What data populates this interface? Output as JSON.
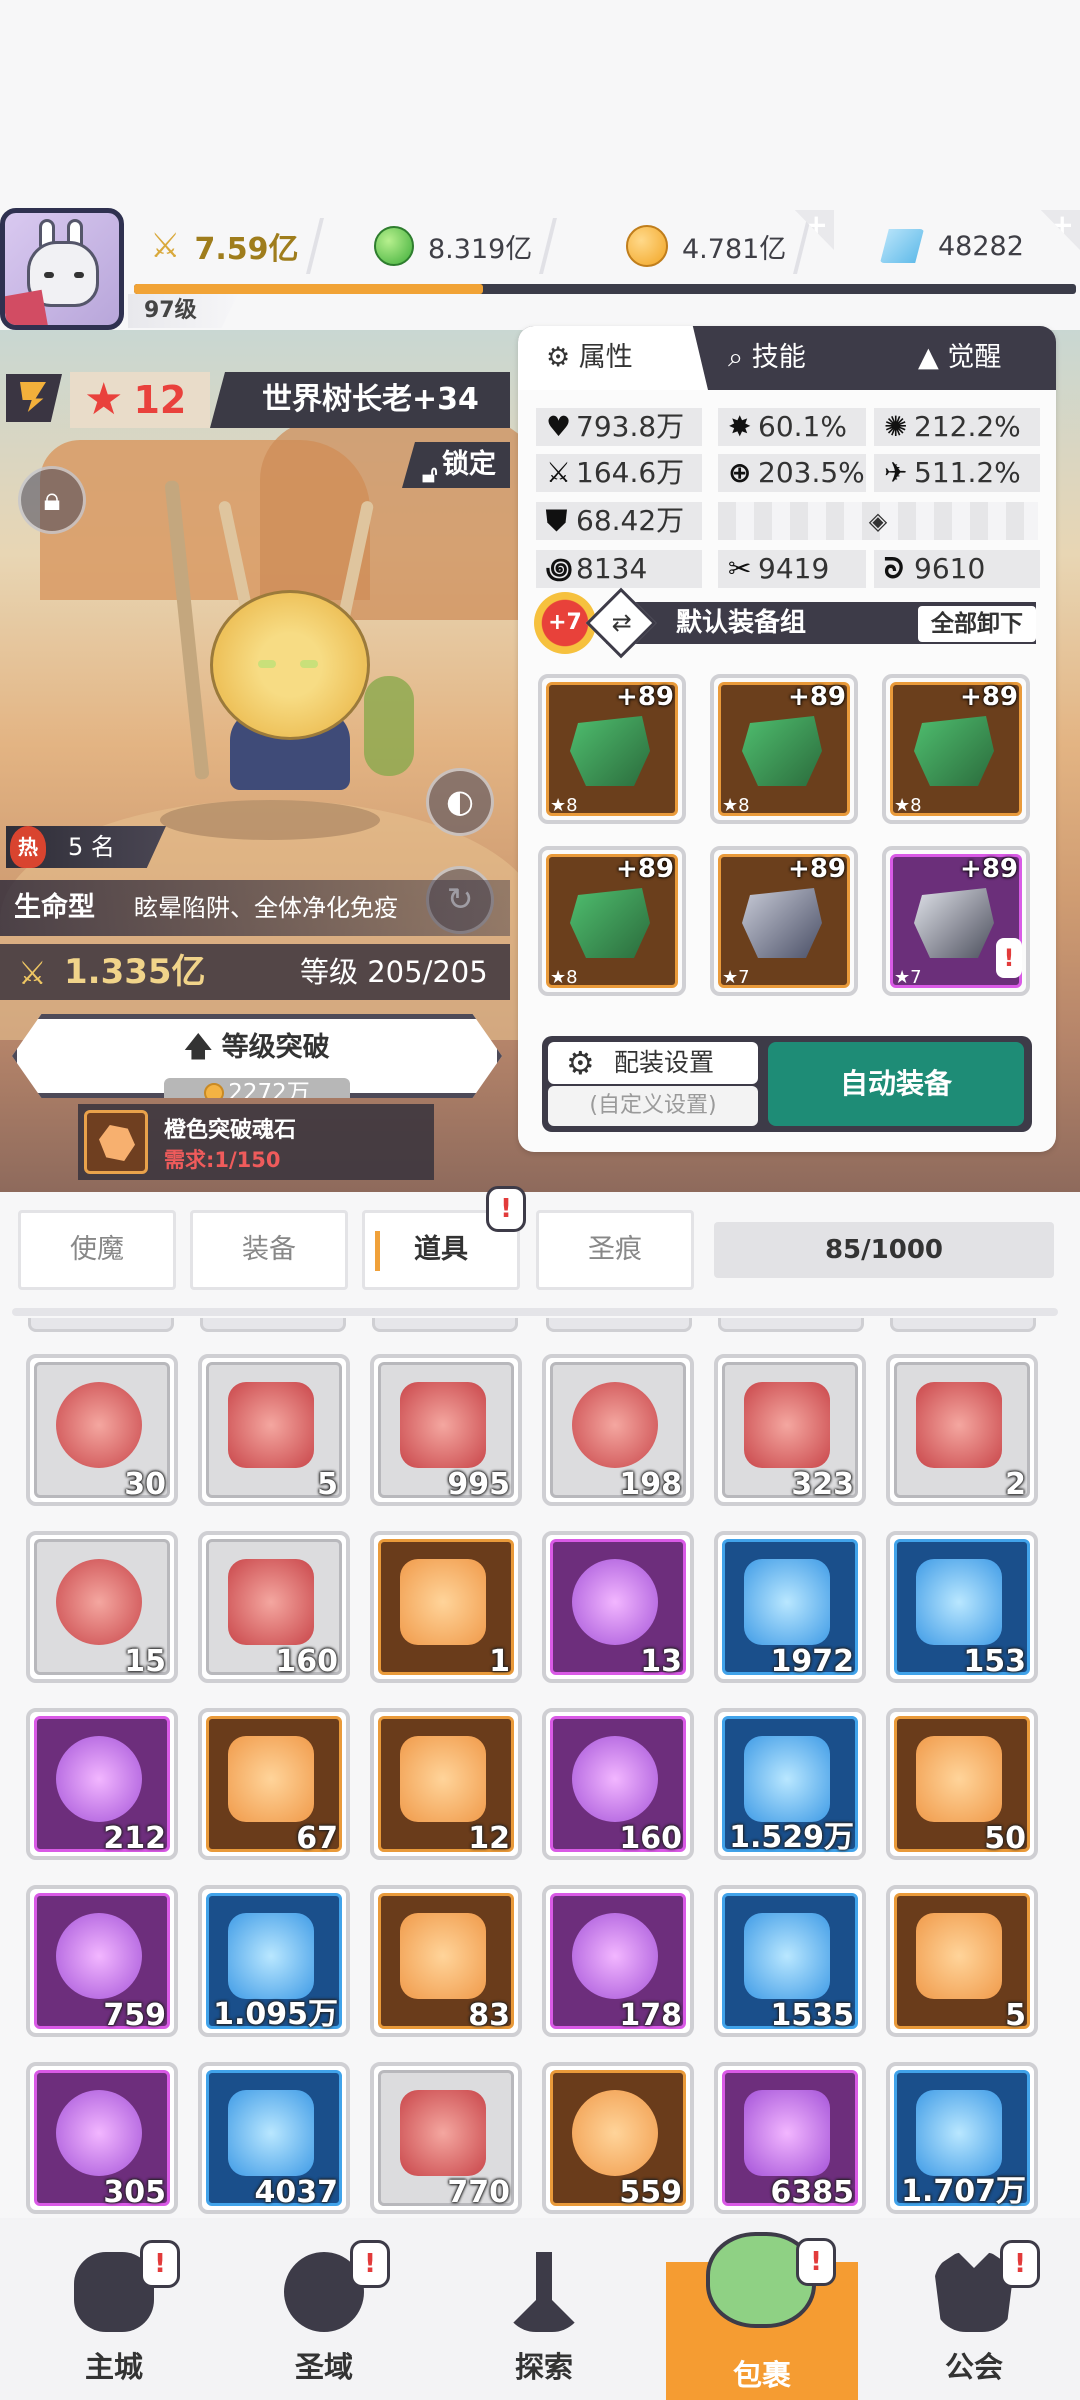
{
  "resources": {
    "power": "7.59亿",
    "green_gem": "8.319亿",
    "gold": "4.781亿",
    "diamond": "48282",
    "player_level": "97级",
    "xp_fraction": 0.37
  },
  "hero": {
    "stars": "12",
    "name": "世界树长老+34",
    "lock_label": "锁定",
    "popularity": "5 名",
    "hot_label": "热",
    "type": "生命型",
    "skills": "眩晕陷阱、全体净化免疫",
    "power": "1.335亿",
    "level": "等级 205/205",
    "breakthrough_label": "等级突破",
    "breakthrough_cost": "2272万",
    "material_name": "橙色突破魂石",
    "material_need": "需求:1/150"
  },
  "panel": {
    "tabs": [
      "属性",
      "技能",
      "觉醒"
    ],
    "stats": {
      "hp": "793.8万",
      "crit": "60.1%",
      "crit_dmg": "212.2%",
      "atk": "164.6万",
      "acc": "203.5%",
      "speed": "511.2%",
      "def": "68.42万",
      "res1": "8134",
      "res2": "9419",
      "res3": "9610"
    },
    "refine": "+7",
    "equip_group": "默认装备组",
    "unload_all": "全部卸下",
    "equipment": [
      {
        "level": "+89",
        "stars": "★8"
      },
      {
        "level": "+89",
        "stars": "★8"
      },
      {
        "level": "+89",
        "stars": "★8"
      },
      {
        "level": "+89",
        "stars": "★8"
      },
      {
        "level": "+89",
        "stars": "★7"
      },
      {
        "level": "+89",
        "stars": "★7"
      }
    ],
    "config_label": "配装设置",
    "config_sub": "(自定义设置)",
    "auto_equip": "自动装备"
  },
  "bag_tabs": [
    "使魔",
    "装备",
    "道具",
    "圣痕"
  ],
  "capacity": "85/1000",
  "items": [
    "30",
    "5",
    "995",
    "198",
    "323",
    "2",
    "15",
    "160",
    "1",
    "13",
    "1972",
    "153",
    "212",
    "67",
    "12",
    "160",
    "1.529万",
    "50",
    "759",
    "1.095万",
    "83",
    "178",
    "1535",
    "5",
    "305",
    "4037",
    "770",
    "559",
    "6385",
    "1.707万"
  ],
  "nav": [
    "主城",
    "圣域",
    "探索",
    "包裹",
    "公会"
  ],
  "colors": {
    "accent_orange": "#f59c32",
    "auto_button": "#1e8c76",
    "dark_panel": "#3d3b48",
    "red_text": "#e9413c"
  }
}
